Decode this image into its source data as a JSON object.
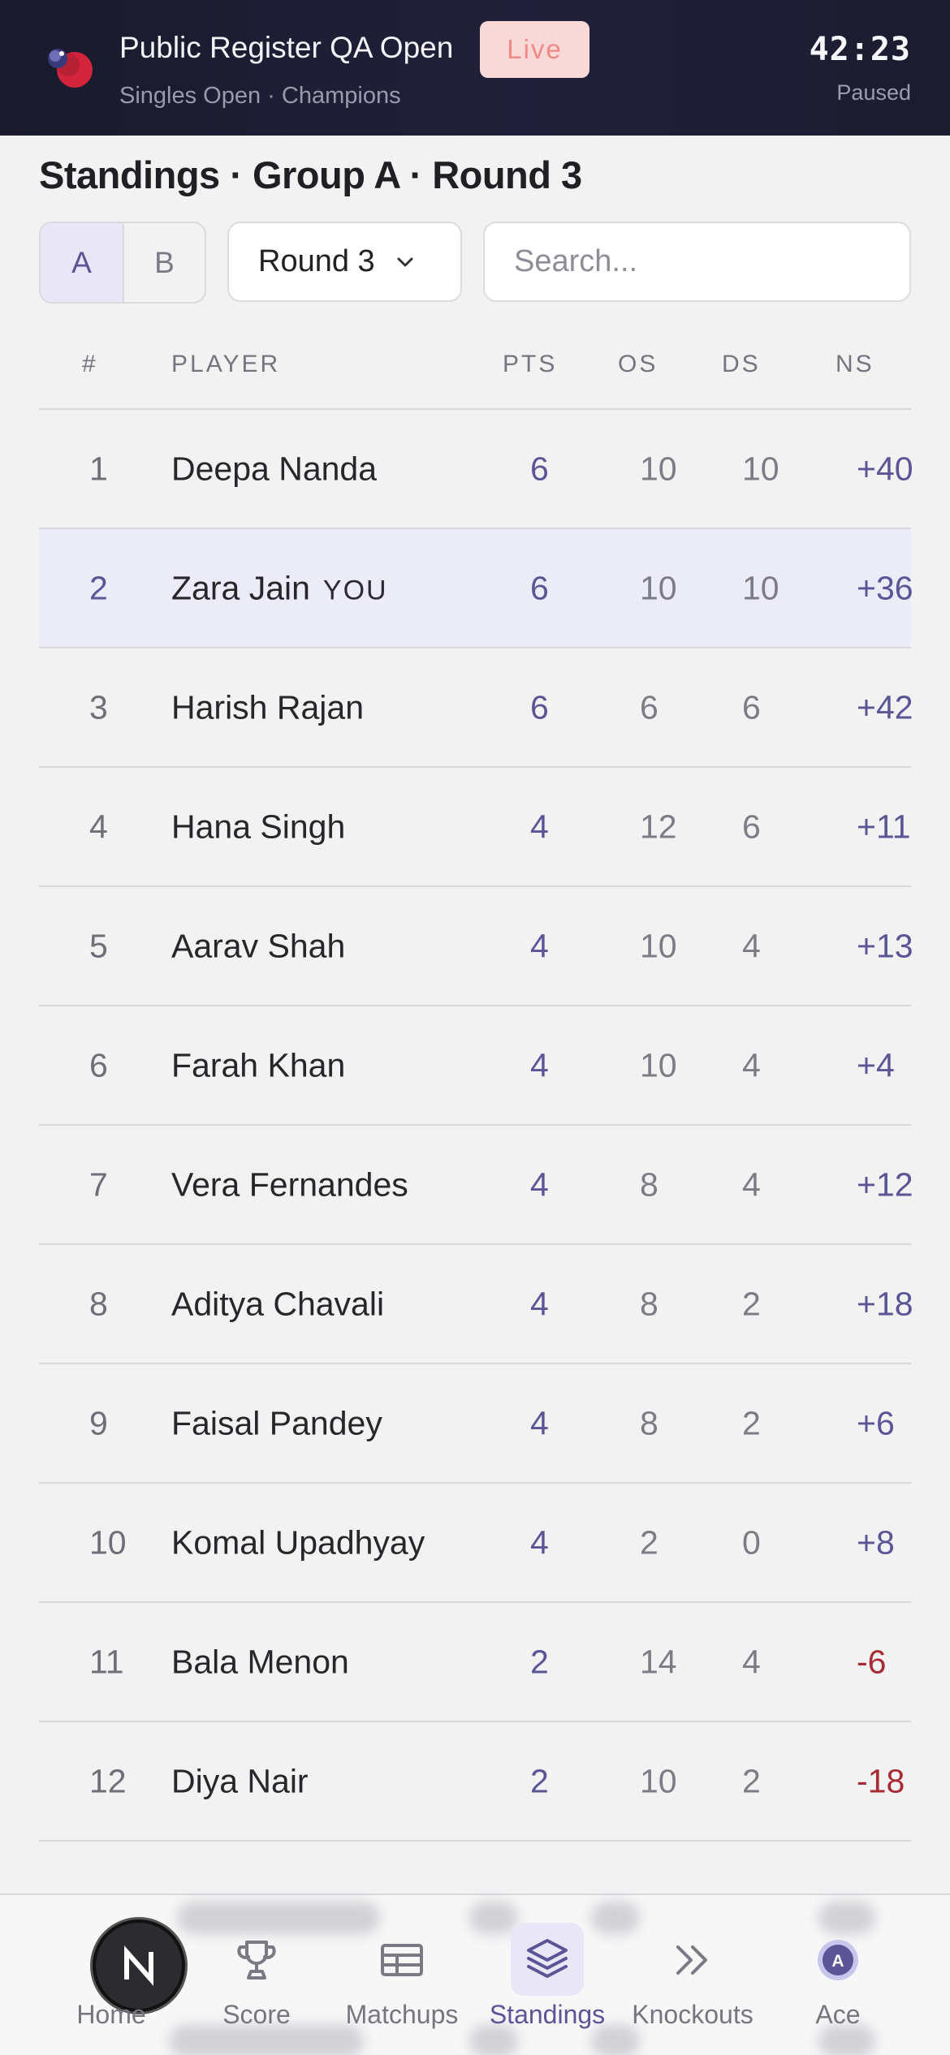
{
  "header": {
    "event_title": "Public Register QA Open",
    "live_badge": "Live",
    "event_subtitle": "Singles Open · Champions",
    "timer": "42:23",
    "timer_status": "Paused"
  },
  "page_title": "Standings · Group A · Round 3",
  "controls": {
    "groups": [
      "A",
      "B"
    ],
    "active_group": "A",
    "round_label": "Round 3",
    "search_placeholder": "Search..."
  },
  "table": {
    "columns": {
      "rank": "#",
      "player": "PLAYER",
      "pts": "PTS",
      "os": "OS",
      "ds": "DS",
      "ns": "NS"
    },
    "you_label": "YOU",
    "rows": [
      {
        "rank": "1",
        "name": "Deepa Nanda",
        "pts": "6",
        "os": "10",
        "ds": "10",
        "ns": "+40",
        "me": false
      },
      {
        "rank": "2",
        "name": "Zara Jain",
        "pts": "6",
        "os": "10",
        "ds": "10",
        "ns": "+36",
        "me": true
      },
      {
        "rank": "3",
        "name": "Harish Rajan",
        "pts": "6",
        "os": "6",
        "ds": "6",
        "ns": "+42",
        "me": false
      },
      {
        "rank": "4",
        "name": "Hana Singh",
        "pts": "4",
        "os": "12",
        "ds": "6",
        "ns": "+11",
        "me": false
      },
      {
        "rank": "5",
        "name": "Aarav Shah",
        "pts": "4",
        "os": "10",
        "ds": "4",
        "ns": "+13",
        "me": false
      },
      {
        "rank": "6",
        "name": "Farah Khan",
        "pts": "4",
        "os": "10",
        "ds": "4",
        "ns": "+4",
        "me": false
      },
      {
        "rank": "7",
        "name": "Vera Fernandes",
        "pts": "4",
        "os": "8",
        "ds": "4",
        "ns": "+12",
        "me": false
      },
      {
        "rank": "8",
        "name": "Aditya Chavali",
        "pts": "4",
        "os": "8",
        "ds": "2",
        "ns": "+18",
        "me": false
      },
      {
        "rank": "9",
        "name": "Faisal Pandey",
        "pts": "4",
        "os": "8",
        "ds": "2",
        "ns": "+6",
        "me": false
      },
      {
        "rank": "10",
        "name": "Komal Upadhyay",
        "pts": "4",
        "os": "2",
        "ds": "0",
        "ns": "+8",
        "me": false
      },
      {
        "rank": "11",
        "name": "Bala Menon",
        "pts": "2",
        "os": "14",
        "ds": "4",
        "ns": "-6",
        "me": false
      },
      {
        "rank": "12",
        "name": "Diya Nair",
        "pts": "2",
        "os": "10",
        "ds": "2",
        "ns": "-18",
        "me": false
      }
    ]
  },
  "nav": {
    "items": [
      {
        "label": "Home",
        "icon": "home-n-icon"
      },
      {
        "label": "Score",
        "icon": "trophy-icon"
      },
      {
        "label": "Matchups",
        "icon": "table-icon"
      },
      {
        "label": "Standings",
        "icon": "layers-icon"
      },
      {
        "label": "Knockouts",
        "icon": "double-chevron-icon"
      },
      {
        "label": "Ace",
        "icon": "avatar-a-icon"
      }
    ],
    "active": "Standings",
    "avatar_letter": "A",
    "home_letter": "N"
  },
  "colors": {
    "accent": "#5b5596",
    "negative": "#a82a33",
    "header_bg": "#1c1c30",
    "live_badge_bg": "#f9d9d8",
    "highlight_row": "#ecebf8"
  }
}
